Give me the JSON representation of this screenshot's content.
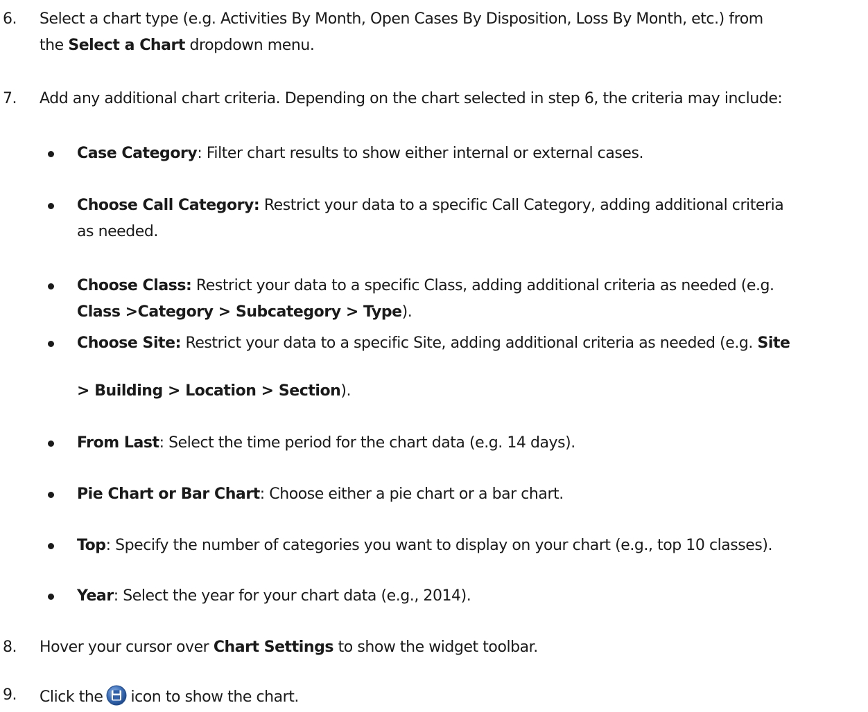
{
  "steps": {
    "s6": {
      "number": "6.",
      "line1": "Select a chart type (e.g. Activities By Month, Open Cases By Disposition, Loss By Month, etc.) from",
      "line2_pre": "the ",
      "line2_bold": "Select a Chart",
      "line2_post": " dropdown menu."
    },
    "s7": {
      "number": "7.",
      "text": "Add any additional chart criteria.  Depending on the chart selected in step 6, the criteria may include:"
    },
    "s8": {
      "number": "8.",
      "pre": "Hover your cursor over ",
      "bold": "Chart Settings",
      "post": " to show the widget toolbar."
    },
    "s9": {
      "number": "9.",
      "pre": "Click the",
      "post": "icon to show the chart.",
      "icon": "save-icon"
    }
  },
  "criteria": {
    "case_category": {
      "bold": "Case Category",
      "text": ": Filter chart results to show either internal or external cases."
    },
    "call_category": {
      "bold": "Choose Call Category:",
      "text1": " Restrict your data to a specific Call Category, adding additional criteria",
      "text2": "as needed."
    },
    "class": {
      "bold": "Choose Class:",
      "text1": " Restrict your data to a specific Class, adding additional criteria as needed (e.g.",
      "path_bold": "Class >Category > Subcategory > Type",
      "path_end": ")."
    },
    "site": {
      "bold": "Choose Site:",
      "text1": " Restrict your data to a specific Site, adding additional criteria as needed (e.g. ",
      "site_bold": "Site",
      "path_bold": "> Building > Location > Section",
      "path_end": ")."
    },
    "from_last": {
      "bold": "From Last",
      "text": ": Select the time period for the chart data (e.g. 14 days)."
    },
    "pie_bar": {
      "bold": "Pie Chart or Bar Chart",
      "text": ": Choose either a pie chart or a bar chart."
    },
    "top": {
      "bold": "Top",
      "text": ": Specify the number of categories you want to display on your chart (e.g., top 10 classes)."
    },
    "year": {
      "bold": "Year",
      "text": ": Select the year for your chart data (e.g., 2014)."
    }
  },
  "colors": {
    "text": "#1a1a1a",
    "icon_blue": "#2f5fa6",
    "icon_light": "#6f98d6"
  }
}
